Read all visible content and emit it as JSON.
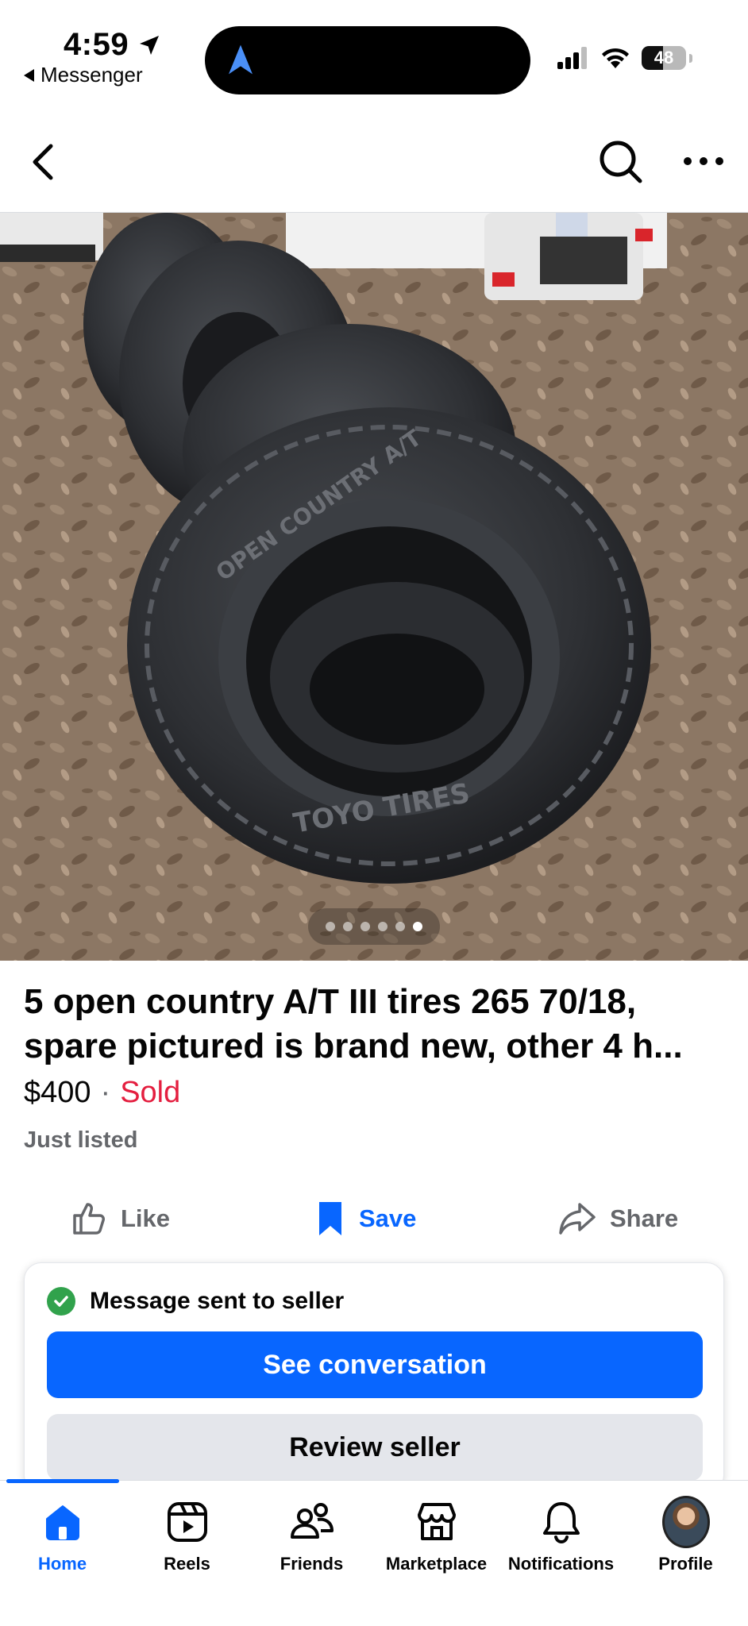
{
  "status_bar": {
    "time": "4:59",
    "back_app": "Messenger",
    "battery": "48",
    "battery_level": 0.48
  },
  "listing": {
    "title": "5 open country A/T III tires 265 70/18, spare pictured is brand new, other 4 h...",
    "price": "$400",
    "separator": "·",
    "status": "Sold",
    "listed": "Just listed",
    "photo_count": 6,
    "active_photo_index": 5
  },
  "actions": {
    "like": "Like",
    "save": "Save",
    "share": "Share"
  },
  "message_card": {
    "status": "Message sent to seller",
    "primary_button": "See conversation",
    "secondary_button": "Review seller"
  },
  "tabbar": {
    "items": [
      {
        "label": "Home",
        "icon": "home-icon",
        "active": true
      },
      {
        "label": "Reels",
        "icon": "reels-icon",
        "active": false
      },
      {
        "label": "Friends",
        "icon": "friends-icon",
        "active": false
      },
      {
        "label": "Marketplace",
        "icon": "marketplace-icon",
        "active": false
      },
      {
        "label": "Notifications",
        "icon": "bell-icon",
        "active": false
      },
      {
        "label": "Profile",
        "icon": "avatar",
        "active": false
      }
    ]
  },
  "colors": {
    "accent": "#0866ff",
    "sold": "#e41e3f",
    "success": "#31a24c",
    "muted_text": "#65676b",
    "secondary_button": "#e4e6eb"
  }
}
